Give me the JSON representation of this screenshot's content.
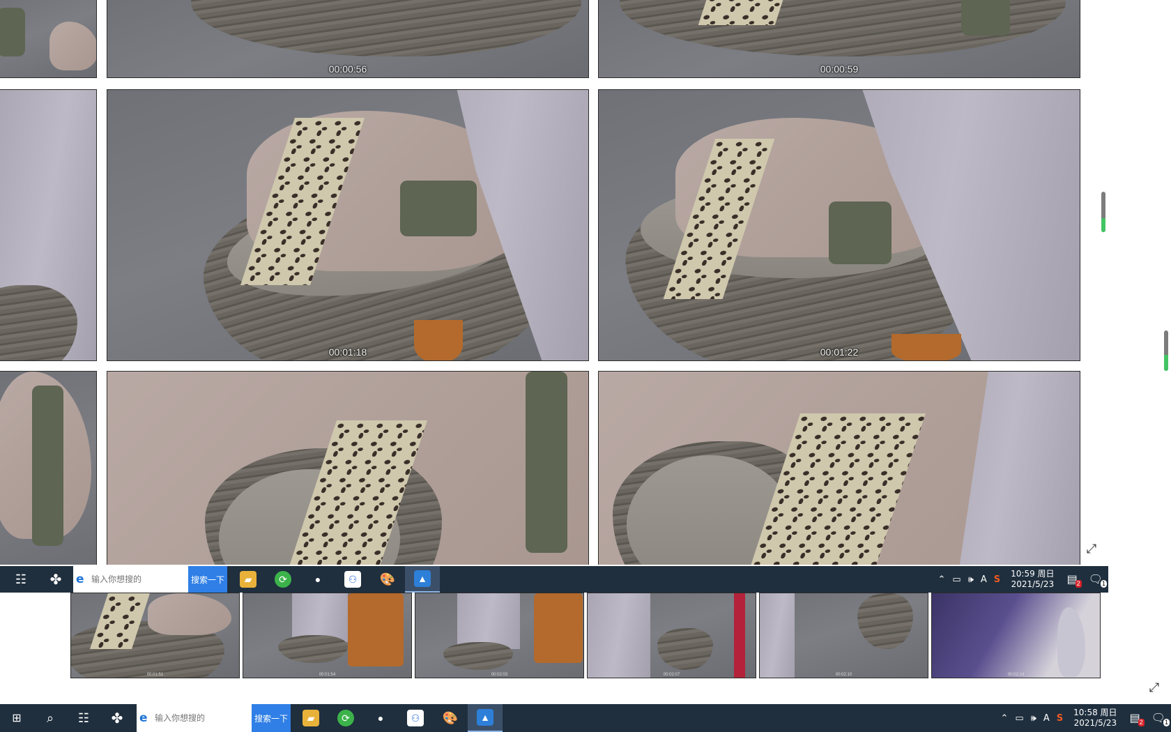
{
  "viewer": {
    "timestamps": [
      "00:00:56",
      "00:00:59",
      "00:01:18",
      "00:01:22"
    ],
    "toolbar": {
      "restore_icon": "restore-window-icon",
      "close_icon": "close-icon",
      "print_icon": "printer-icon",
      "more_icon": "more-options-icon"
    },
    "scroll_progress_primary": 0.35,
    "scroll_progress_secondary": 0.4
  },
  "taskbar_inner": {
    "search_placeholder": "输入你想搜的",
    "search_button": "搜索一下",
    "time": "10:59 周日",
    "date": "2021/5/23",
    "notif_badge": "2",
    "action_center_badge": "1"
  },
  "taskbar_outer": {
    "search_placeholder": "输入你想搜的",
    "search_button": "搜索一下",
    "time": "10:58 周日",
    "date": "2021/5/23",
    "notif_badge": "2",
    "action_center_badge": "1"
  },
  "filmstrip": {
    "timestamps": [
      "00:01:51",
      "00:01:54",
      "00:02:03",
      "00:02:07",
      "00:02:10",
      "00:02:14"
    ]
  },
  "colors": {
    "taskbar_bg": "#1f2f3e",
    "search_button_bg": "#2f7fe6",
    "scroll_fill": "#43c463"
  }
}
